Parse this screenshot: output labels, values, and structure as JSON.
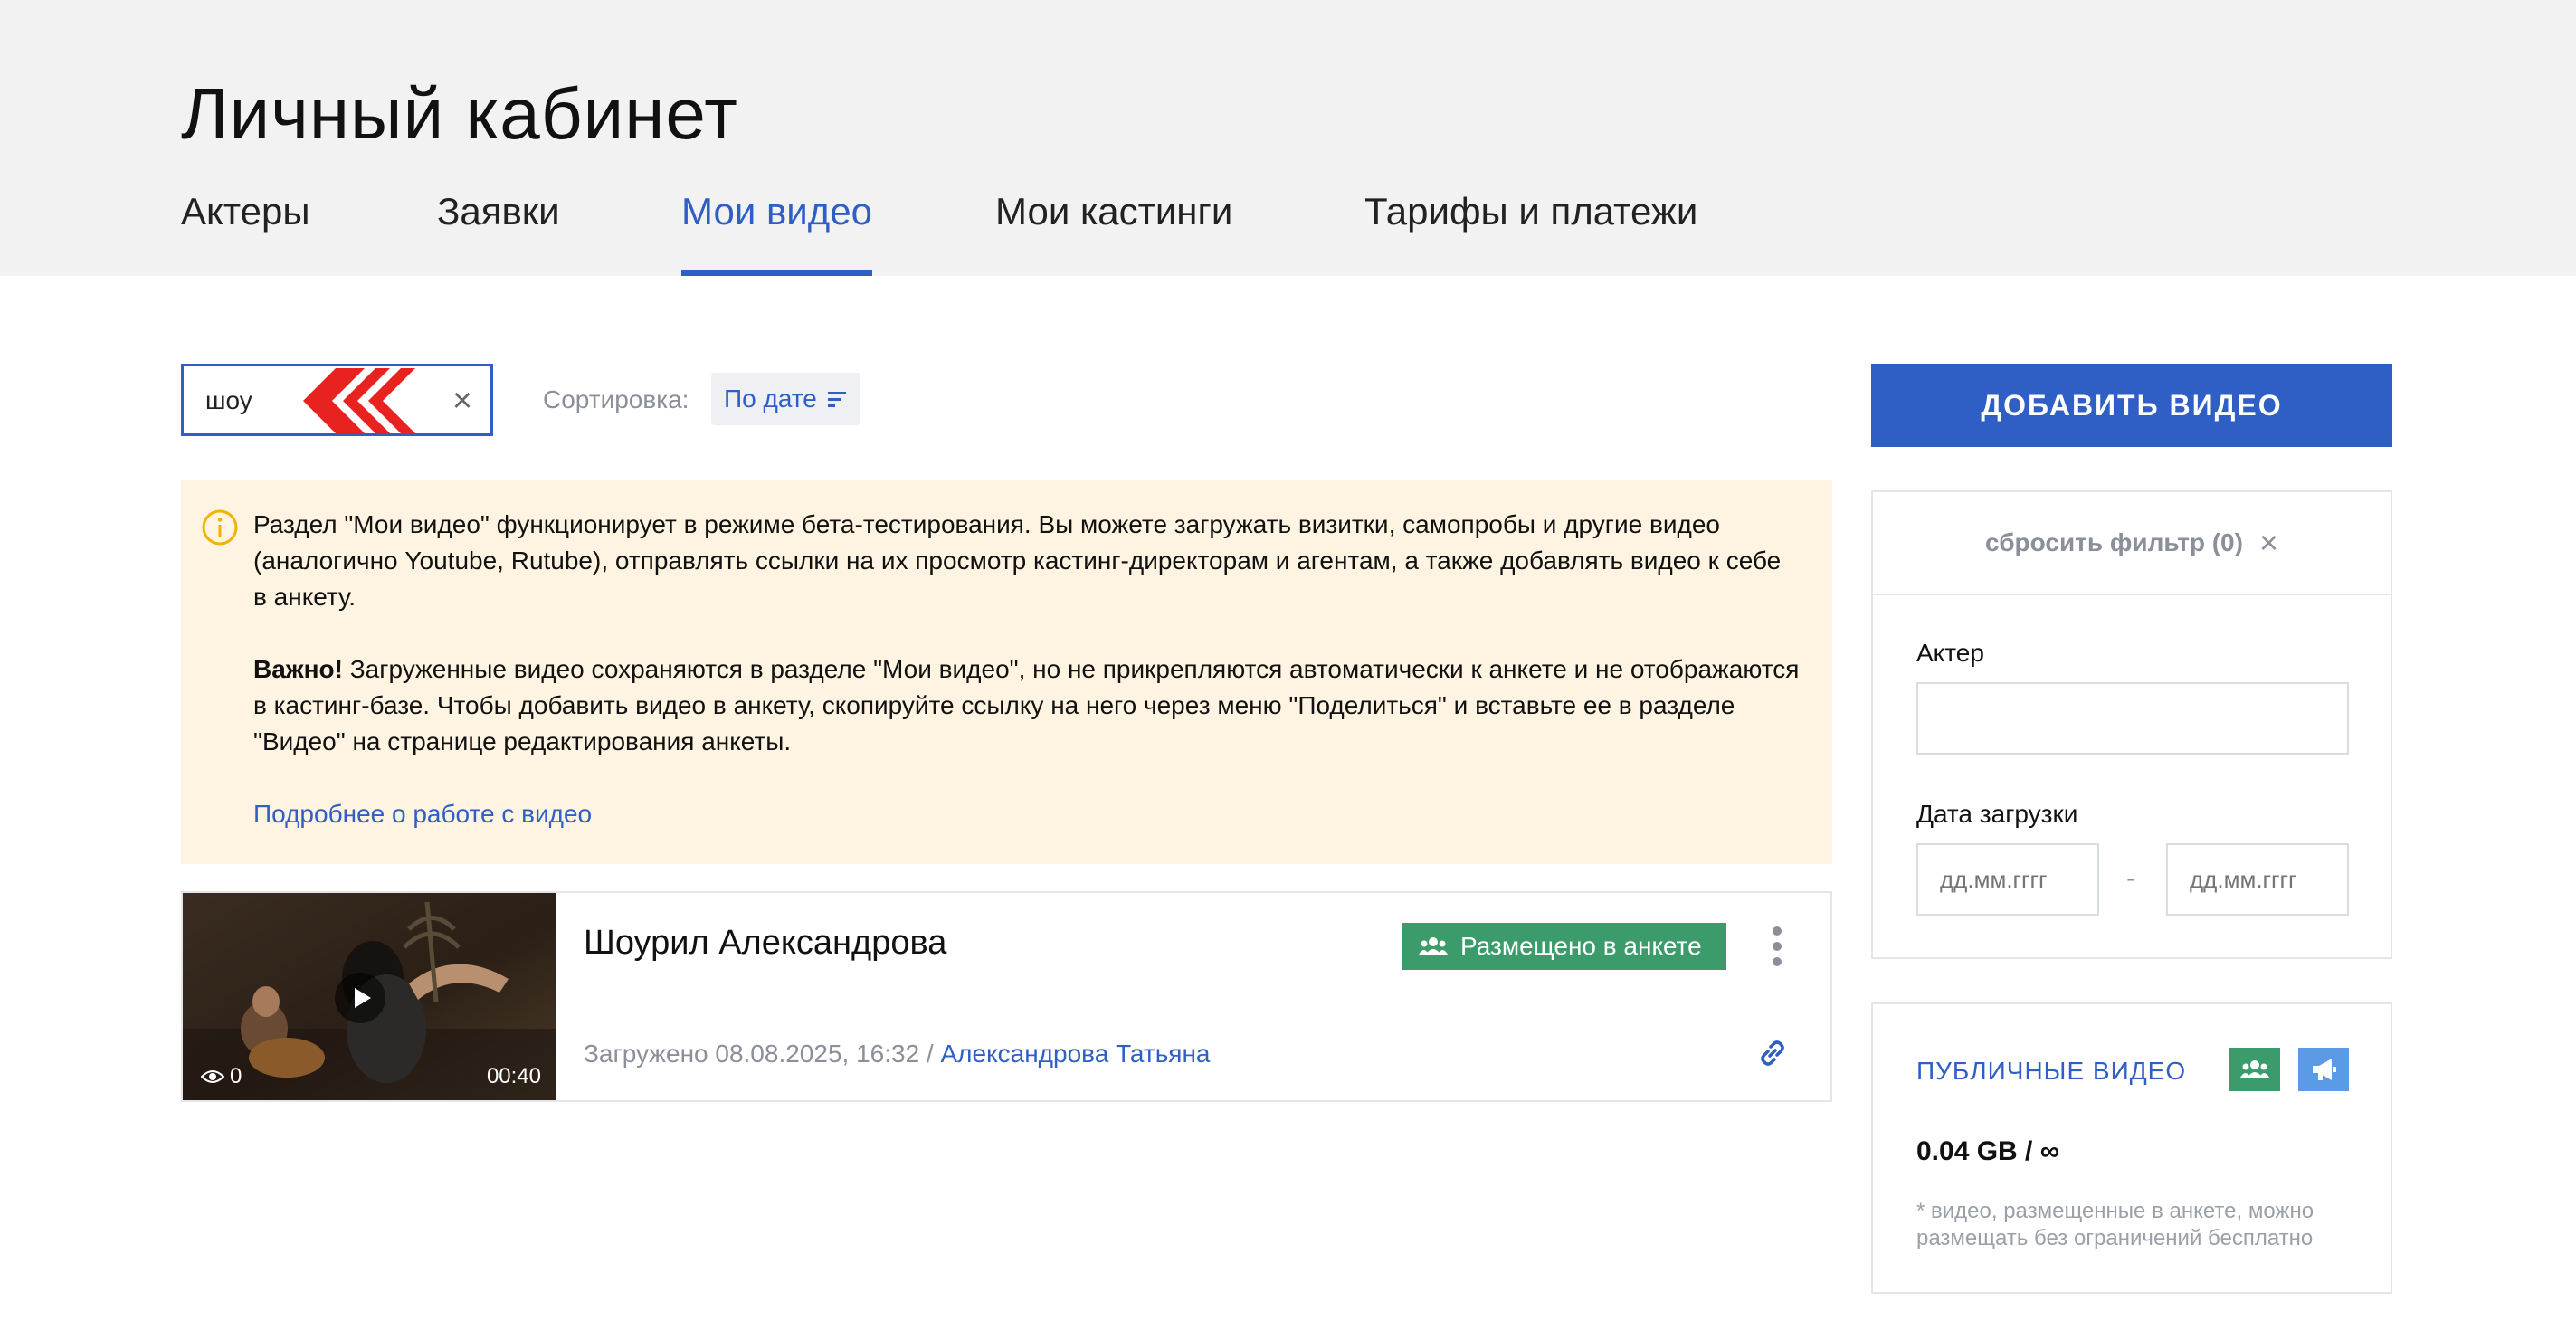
{
  "header": {
    "title": "Личный кабинет",
    "tabs": [
      {
        "label": "Актеры"
      },
      {
        "label": "Заявки"
      },
      {
        "label": "Мои видео"
      },
      {
        "label": "Мои кастинги"
      },
      {
        "label": "Тарифы и платежи"
      }
    ],
    "active_tab": "Мои видео"
  },
  "search": {
    "value": "шоу"
  },
  "sort": {
    "label": "Сортировка:",
    "value": "По дате"
  },
  "notice": {
    "p1": "Раздел \"Мои видео\" функционирует в режиме бета-тестирования. Вы можете загружать визитки, самопробы и другие видео (аналогично Youtube, Rutube), отправлять ссылки на их просмотр кастинг-директорам и агентам, а также добавлять видео к себе в анкету.",
    "p2_bold": "Важно!",
    "p2": " Загруженные видео сохраняются в разделе \"Мои видео\", но не прикрепляются автоматически к анкете и не отображаются в кастинг-базе. Чтобы добавить видео в анкету, скопируйте ссылку на него через меню \"Поделиться\" и вставьте ее в разделе \"Видео\" на странице редактирования анкеты.",
    "link": "Подробнее о работе с видео"
  },
  "videos": [
    {
      "title": "Шоурил Александрова",
      "views": "0",
      "duration": "00:40",
      "badge": "Размещено в анкете",
      "uploaded": "Загружено 08.08.2025, 16:32 / ",
      "author": "Александрова Татьяна"
    }
  ],
  "sidebar": {
    "add_button": "ДОБАВИТЬ ВИДЕО",
    "reset_filter": "сбросить фильтр (0)",
    "actor_label": "Актер",
    "date_label": "Дата загрузки",
    "date_from_placeholder": "дд.мм.гггг",
    "date_to_placeholder": "дд.мм.гггг",
    "date_separator": "-",
    "public_title": "ПУБЛИЧНЫЕ ВИДЕО",
    "storage": "0.04 GB / ∞",
    "public_note": "* видео, размещенные в анкете, можно размещать без ограничений бесплатно"
  },
  "colors": {
    "accent": "#2f5fc4",
    "badge_green": "#3b9b6b",
    "badge_blue": "#5b9be6",
    "notice_bg": "#fff4e1",
    "chevron_red": "#e8231f"
  }
}
